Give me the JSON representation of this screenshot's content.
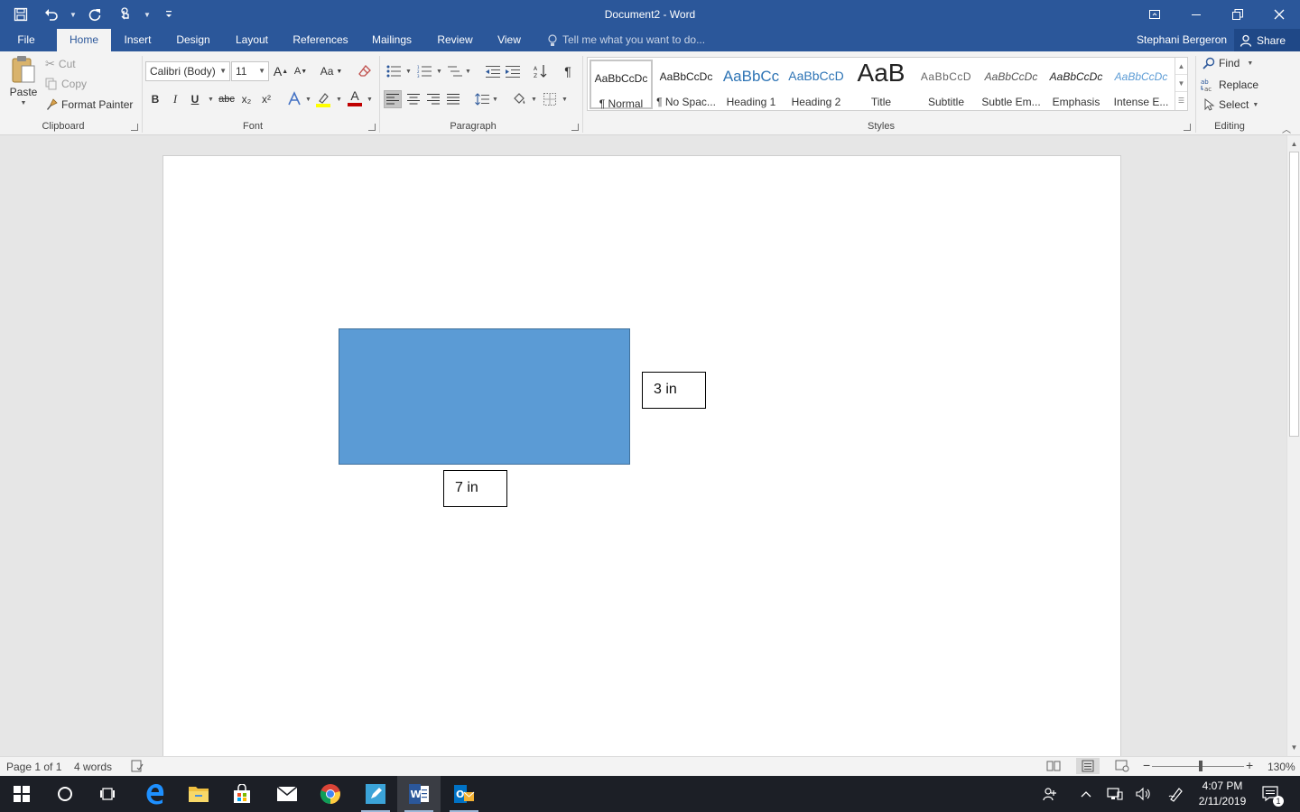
{
  "window": {
    "title": "Document2 - Word",
    "qat": {
      "save": "save-icon",
      "undo": "undo-icon",
      "redo": "redo-icon",
      "touch": "touch-mode-icon",
      "customize": "customize-qat-icon"
    },
    "controls": {
      "ribbon_display": "ribbon-display-icon",
      "minimize": "minimize-icon",
      "restore": "restore-icon",
      "close": "close-icon"
    }
  },
  "tabs": {
    "file": "File",
    "home": "Home",
    "insert": "Insert",
    "design": "Design",
    "layout": "Layout",
    "references": "References",
    "mailings": "Mailings",
    "review": "Review",
    "view": "View"
  },
  "tell_me": "Tell me what you want to do...",
  "user": "Stephani Bergeron",
  "share": "Share",
  "clipboard": {
    "paste": "Paste",
    "cut": "Cut",
    "copy": "Copy",
    "format_painter": "Format Painter",
    "label": "Clipboard"
  },
  "font": {
    "name": "Calibri (Body)",
    "size": "11",
    "change_case": "Aa",
    "bold": "B",
    "italic": "I",
    "underline": "U",
    "strike": "abc",
    "subscript": "x₂",
    "superscript": "x²",
    "font_color": "A",
    "label": "Font"
  },
  "paragraph": {
    "label": "Paragraph",
    "pilcrow": "¶"
  },
  "styles": {
    "label": "Styles",
    "items": [
      {
        "sample": "AaBbCcDc",
        "name": "¶ Normal"
      },
      {
        "sample": "AaBbCcDc",
        "name": "¶ No Spac..."
      },
      {
        "sample": "AaBbCc",
        "name": "Heading 1"
      },
      {
        "sample": "AaBbCcD",
        "name": "Heading 2"
      },
      {
        "sample": "AaB",
        "name": "Title"
      },
      {
        "sample": "AaBbCcD",
        "name": "Subtitle"
      },
      {
        "sample": "AaBbCcDc",
        "name": "Subtle Em..."
      },
      {
        "sample": "AaBbCcDc",
        "name": "Emphasis"
      },
      {
        "sample": "AaBbCcDc",
        "name": "Intense E..."
      }
    ]
  },
  "editing": {
    "find": "Find",
    "replace": "Replace",
    "select": "Select",
    "label": "Editing"
  },
  "document": {
    "shape_color": "#5b9bd5",
    "height_label": "3 in",
    "width_label": "7 in"
  },
  "status": {
    "page": "Page 1 of 1",
    "words": "4 words",
    "zoom": "130%",
    "zoom_minus": "−",
    "zoom_plus": "+"
  },
  "taskbar": {
    "time": "4:07 PM",
    "date": "2/11/2019",
    "notification_count": "1"
  }
}
